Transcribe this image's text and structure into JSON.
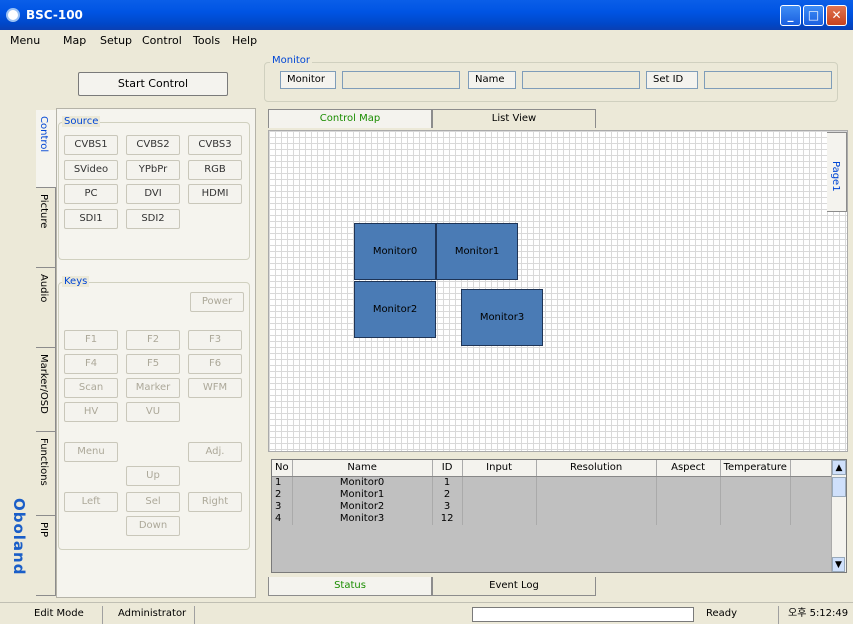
{
  "window": {
    "title": "BSC-100"
  },
  "menu": [
    "Menu",
    "Map",
    "Setup",
    "Control",
    "Tools",
    "Help"
  ],
  "start_control_label": "Start Control",
  "monitor_group": {
    "title": "Monitor",
    "monitor_label": "Monitor",
    "monitor_value": "",
    "name_label": "Name",
    "name_value": "",
    "setid_label": "Set ID",
    "setid_value": ""
  },
  "side_tabs": [
    "Control",
    "Picture",
    "Audio",
    "Marker/OSD",
    "Functions",
    "PIP"
  ],
  "logo_text": "Oboland",
  "source": {
    "title": "Source",
    "buttons": [
      "CVBS1",
      "CVBS2",
      "CVBS3",
      "SVideo",
      "YPbPr",
      "RGB",
      "PC",
      "DVI",
      "HDMI",
      "SDI1",
      "SDI2"
    ]
  },
  "keys": {
    "title": "Keys",
    "power": "Power",
    "f_keys": [
      "F1",
      "F2",
      "F3",
      "F4",
      "F5",
      "F6"
    ],
    "scan": "Scan",
    "marker": "Marker",
    "wfm": "WFM",
    "hv": "HV",
    "vu": "VU",
    "menu": "Menu",
    "adj": "Adj.",
    "up": "Up",
    "left": "Left",
    "sel": "Sel",
    "right": "Right",
    "down": "Down"
  },
  "map_tabs": [
    "Control Map",
    "List View"
  ],
  "page_tab": "Page1",
  "monitors_on_map": [
    "Monitor0",
    "Monitor1",
    "Monitor2",
    "Monitor3"
  ],
  "table": {
    "columns": [
      "No",
      "Name",
      "ID",
      "Input",
      "Resolution",
      "Aspect",
      "Temperature"
    ],
    "rows": [
      [
        "1",
        "Monitor0",
        "1",
        "",
        "",
        "",
        ""
      ],
      [
        "2",
        "Monitor1",
        "2",
        "",
        "",
        "",
        ""
      ],
      [
        "3",
        "Monitor2",
        "3",
        "",
        "",
        "",
        ""
      ],
      [
        "4",
        "Monitor3",
        "12",
        "",
        "",
        "",
        ""
      ]
    ]
  },
  "bottom_tabs": [
    "Status",
    "Event Log"
  ],
  "statusbar": {
    "mode": "Edit Mode",
    "user": "Administrator",
    "state": "Ready",
    "time": "오후 5:12:49"
  },
  "colors": {
    "accent": "#0046d5",
    "monitor": "#4a7bb5",
    "active_tab": "#1a8d00"
  }
}
